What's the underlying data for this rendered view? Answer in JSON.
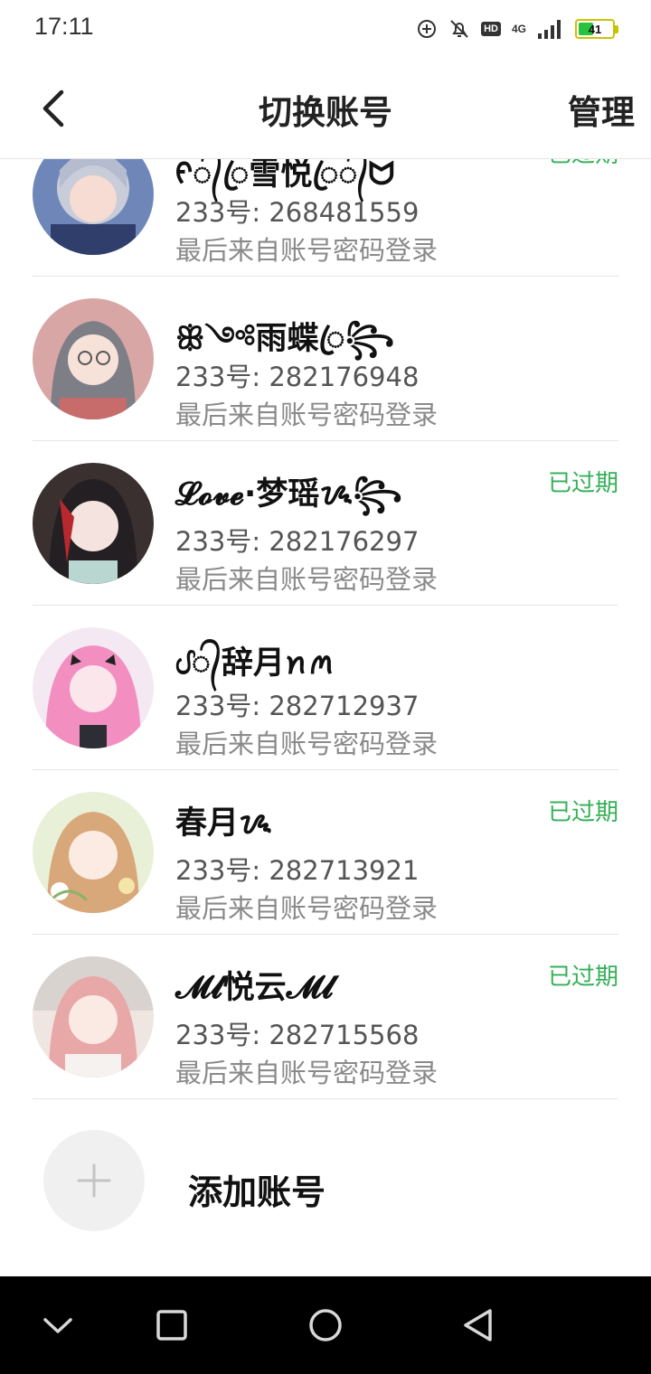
{
  "status_bar": {
    "time": "17:11",
    "hd_label": "HD",
    "network_label": "4G",
    "battery_level": "41",
    "battery_fraction": 0.41,
    "icons": [
      "sync-icon",
      "mute-icon",
      "hd-icon",
      "network-4g-icon",
      "signal-icon",
      "battery-icon"
    ]
  },
  "header": {
    "title": "切换账号",
    "manage_label": "管理",
    "back_icon": "chevron-left-icon"
  },
  "accounts": [
    {
      "name": "ᠻ᭄ꦿ雪悦ꦿ᭄ᗢ",
      "id_text": "233号: 268481559",
      "login_text": "最后来自账号密码登录",
      "expired": "已过期"
    },
    {
      "name": "ꕥ༺雨蝶ꦿ꧂",
      "id_text": "233号: 282176948",
      "login_text": "最后来自账号密码登录",
      "expired": ""
    },
    {
      "name": "𝓛𝓸𝓿𝓮·梦瑶ᝰ꧂",
      "id_text": "233号: 282176297",
      "login_text": "最后来自账号密码登录",
      "expired": "已过期"
    },
    {
      "name": "ᦔ᭄辞月ꪀꪔ",
      "id_text": "233号: 282712937",
      "login_text": "最后来自账号密码登录",
      "expired": ""
    },
    {
      "name": "春月ᝰ",
      "id_text": "233号: 282713921",
      "login_text": "最后来自账号密码登录",
      "expired": "已过期"
    },
    {
      "name": "𝓜𝓵悦云𝓜𝓵",
      "id_text": "233号: 282715568",
      "login_text": "最后来自账号密码登录",
      "expired": "已过期"
    }
  ],
  "add_account": {
    "label": "添加账号",
    "icon": "plus-icon"
  },
  "nav_bar": {
    "icons": [
      "chevron-down-icon",
      "square-icon",
      "circle-icon",
      "triangle-back-icon"
    ]
  },
  "colors": {
    "expired_text": "#35b057",
    "background": "#ffffff",
    "nav_bar": "#000000"
  }
}
